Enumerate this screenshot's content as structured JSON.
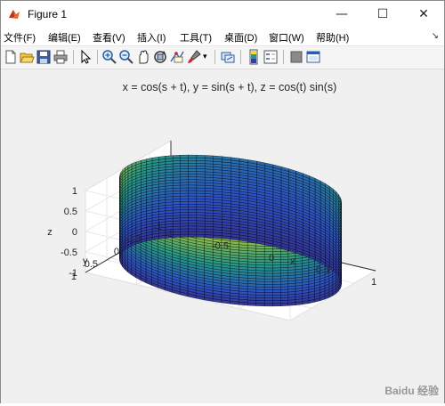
{
  "window": {
    "title": "Figure 1",
    "minimize_glyph": "—",
    "maximize_glyph": "☐",
    "close_glyph": "✕"
  },
  "menu": [
    {
      "label": "文件(F)"
    },
    {
      "label": "编辑(E)"
    },
    {
      "label": "查看(V)"
    },
    {
      "label": "插入(I)"
    },
    {
      "label": "工具(T)"
    },
    {
      "label": "桌面(D)"
    },
    {
      "label": "窗口(W)"
    },
    {
      "label": "帮助(H)"
    }
  ],
  "toolbar": {
    "icons": [
      "new-figure-icon",
      "open-file-icon",
      "save-figure-icon",
      "print-figure-icon",
      "edit-plot-icon",
      "zoom-in-icon",
      "zoom-out-icon",
      "pan-icon",
      "rotate-3d-icon",
      "data-cursor-icon",
      "brush-icon",
      "brush-dropdown-icon",
      "link-plot-icon",
      "insert-colorbar-icon",
      "insert-legend-icon",
      "hide-plot-tools-icon",
      "show-plot-tools-icon"
    ]
  },
  "colors": {
    "surface_low": "#3b1a6e",
    "surface_mid": "#23988a",
    "surface_high": "#f2dc2c",
    "edge": "#000000",
    "axes_bg": "#f0f0f0"
  },
  "chart_data": {
    "type": "surface",
    "title": "x = cos(s + t), y = sin(s + t), z = cos(t) sin(s)",
    "xlabel": "x",
    "ylabel": "y",
    "zlabel": "z",
    "xlim": [
      -1,
      1
    ],
    "ylim": [
      -1,
      1
    ],
    "zlim": [
      -1,
      1
    ],
    "x_ticks": [
      "-1",
      "-0.5",
      "0",
      "0.5",
      "1"
    ],
    "y_ticks": [
      "-1",
      "-0.5",
      "0",
      "0.5",
      "1"
    ],
    "z_ticks": [
      "-1",
      "-0.5",
      "0",
      "0.5",
      "1"
    ],
    "colormap": "parula",
    "grid": true,
    "box": "open 3-D axes box"
  },
  "watermark": "Baidu 经验"
}
